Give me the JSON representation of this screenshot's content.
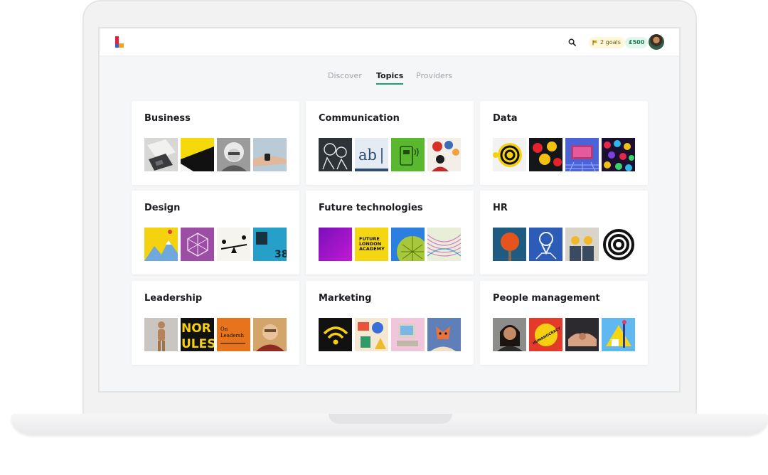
{
  "header": {
    "logo": "learnerbly-logo",
    "goals_label": "2 goals",
    "credit_label": "£500"
  },
  "tabs": [
    {
      "label": "Discover",
      "active": false
    },
    {
      "label": "Topics",
      "active": true
    },
    {
      "label": "Providers",
      "active": false
    }
  ],
  "topics": [
    {
      "title": "Business"
    },
    {
      "title": "Communication"
    },
    {
      "title": "Data"
    },
    {
      "title": "Design"
    },
    {
      "title": "Future technologies"
    },
    {
      "title": "HR"
    },
    {
      "title": "Leadership"
    },
    {
      "title": "Marketing"
    },
    {
      "title": "People management"
    }
  ],
  "thumb_text": {
    "communication_ab": "ab",
    "future_academy": [
      "FUTURE",
      "LONDON",
      "ACADEMY"
    ],
    "leadership_book": [
      "On",
      "Leadersh"
    ],
    "leadership_poster": [
      "NOR",
      "ULES"
    ],
    "people_book": "HUMANOCRACY"
  },
  "colors": {
    "accent": "#19a37a",
    "background": "#f5f6f7",
    "card": "#ffffff"
  }
}
